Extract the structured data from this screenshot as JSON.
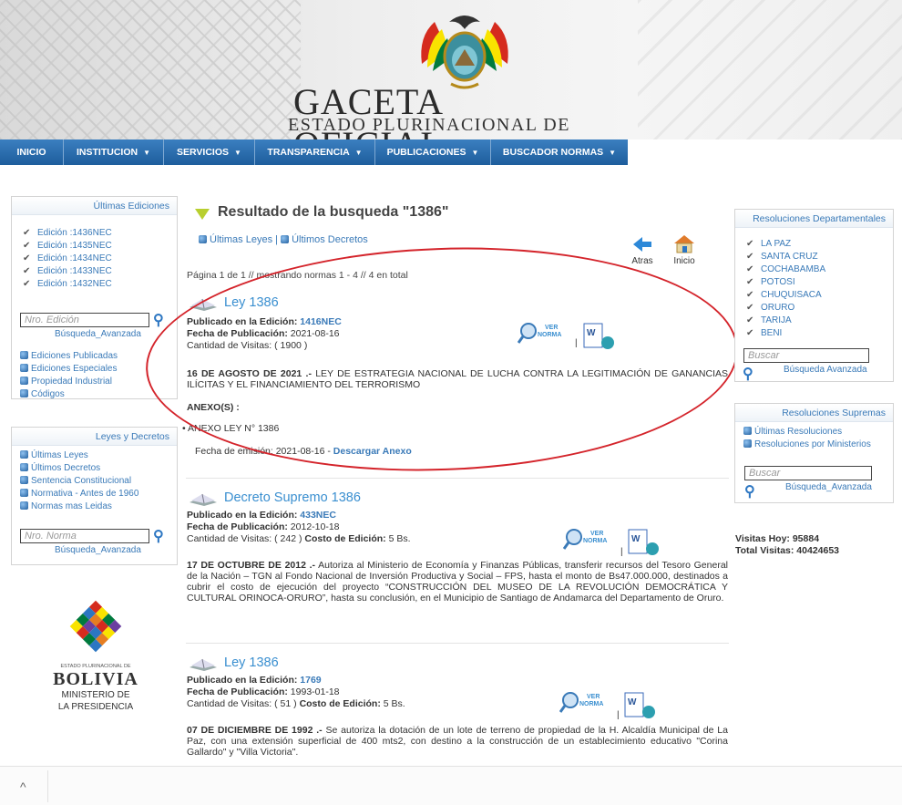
{
  "header": {
    "title_left": "GACETA",
    "title_right": "OFICIAL",
    "subtitle": "ESTADO PLURINACIONAL DE BOLIVIA"
  },
  "nav": [
    {
      "label": "INICIO",
      "dropdown": false
    },
    {
      "label": "INSTITUCION",
      "dropdown": true
    },
    {
      "label": "SERVICIOS",
      "dropdown": true
    },
    {
      "label": "TRANSPARENCIA",
      "dropdown": true
    },
    {
      "label": "PUBLICACIONES",
      "dropdown": true
    },
    {
      "label": "BUSCADOR NORMAS",
      "dropdown": true
    }
  ],
  "left_editions": {
    "title": "Últimas Ediciones",
    "items": [
      "Edición :1436NEC",
      "Edición :1435NEC",
      "Edición :1434NEC",
      "Edición :1433NEC",
      "Edición :1432NEC"
    ],
    "search_placeholder": "Nro. Edición",
    "advanced": "Búsqueda_Avanzada",
    "links": [
      "Ediciones Publicadas",
      "Ediciones Especiales",
      "Propiedad Industrial",
      "Códigos"
    ]
  },
  "left_laws": {
    "title": "Leyes y Decretos",
    "links": [
      "Últimas Leyes",
      "Últimos Decretos",
      "Sentencia Constitucional",
      "Normativa - Antes de 1960",
      "Normas mas Leidas"
    ],
    "search_placeholder": "Nro. Norma",
    "advanced": "Búsqueda_Avanzada"
  },
  "logo": {
    "small": "ESTADO PLURINACIONAL DE",
    "big": "BOLIVIA",
    "line1": "MINISTERIO DE",
    "line2": "LA PRESIDENCIA"
  },
  "main": {
    "title": "Resultado de la busqueda \"1386\"",
    "link_leyes": "Últimas Leyes",
    "link_sep": "|",
    "link_decretos": "Últimos Decretos",
    "atras": "Atras",
    "inicio": "Inicio",
    "pagination": "Página 1 de 1 // mostrando normas 1 - 4 // 4 en total",
    "ver": "VER",
    "norma": "NORMA",
    "pipe": "|"
  },
  "entries": [
    {
      "title": "Ley 1386",
      "edition_label": "Publicado en la Edición:",
      "edition": "1416NEC",
      "date_label": "Fecha de Publicación:",
      "date": "2021-08-16",
      "visits_label": "Cantidad de Visitas:",
      "visits": "( 1900 )",
      "cost_label": "",
      "cost": "",
      "desc_date": "16 DE AGOSTO DE 2021 .-",
      "desc": "LEY DE ESTRATEGIA NACIONAL DE LUCHA CONTRA LA LEGITIMACIÓN DE GANANCIAS ILÍCITAS Y EL FINANCIAMIENTO DEL TERRORISMO",
      "annex_label": "ANEXO(S) :",
      "annex_item": "ANEXO LEY N° 1386",
      "annex_date_label": "Fecha de emisión:",
      "annex_date": "2021-08-16",
      "annex_dash": "-",
      "annex_link": "Descargar Anexo"
    },
    {
      "title": "Decreto Supremo 1386",
      "edition_label": "Publicado en la Edición:",
      "edition": "433NEC",
      "date_label": "Fecha de Publicación:",
      "date": "2012-10-18",
      "visits_label": "Cantidad de Visitas:",
      "visits": "( 242 )",
      "cost_label": "Costo de Edición:",
      "cost": "5 Bs.",
      "desc_date": "17 DE OCTUBRE DE 2012 .-",
      "desc": "Autoriza al Ministerio de Economía y Finanzas Públicas, transferir recursos del Tesoro General de la Nación – TGN al Fondo Nacional de Inversión Productiva y Social – FPS, hasta el monto de Bs47.000.000, destinados a cubrir el costo de ejecución del proyecto “CONSTRUCCIÓN DEL MUSEO DE LA REVOLUCIÓN DEMOCRÁTICA Y CULTURAL ORINOCA-ORURO”, hasta su conclusión, en el Municipio de Santiago de Andamarca del Departamento de Oruro."
    },
    {
      "title": "Ley 1386",
      "edition_label": "Publicado en la Edición:",
      "edition": "1769",
      "date_label": "Fecha de Publicación:",
      "date": "1993-01-18",
      "visits_label": "Cantidad de Visitas:",
      "visits": "( 51 )",
      "cost_label": "Costo de Edición:",
      "cost": "5 Bs.",
      "desc_date": "07 DE DICIEMBRE DE 1992 .-",
      "desc": "Se autoriza la dotación de un lote de terreno de propiedad de la H. Alcaldía Municipal de La Paz, con una extensión superficial de 400 mts2, con destino a la construcción de un establecimiento educativo \"Corina Gallardo\" y \"Villa Victoria\"."
    }
  ],
  "right_dept": {
    "title": "Resoluciones Departamentales",
    "items": [
      "LA PAZ",
      "SANTA CRUZ",
      "COCHABAMBA",
      "POTOSI",
      "CHUQUISACA",
      "ORURO",
      "TARIJA",
      "BENI"
    ],
    "search_placeholder": "Buscar",
    "advanced": "Búsqueda Avanzada"
  },
  "right_supreme": {
    "title": "Resoluciones Supremas",
    "links": [
      "Últimas Resoluciones",
      "Resoluciones por Ministerios"
    ],
    "search_placeholder": "Buscar",
    "advanced": "Búsqueda_Avanzada"
  },
  "stats": {
    "today": "Visitas Hoy: 95884",
    "total": "Total Visitas: 40424653"
  },
  "bottom": {
    "caret": "^"
  }
}
